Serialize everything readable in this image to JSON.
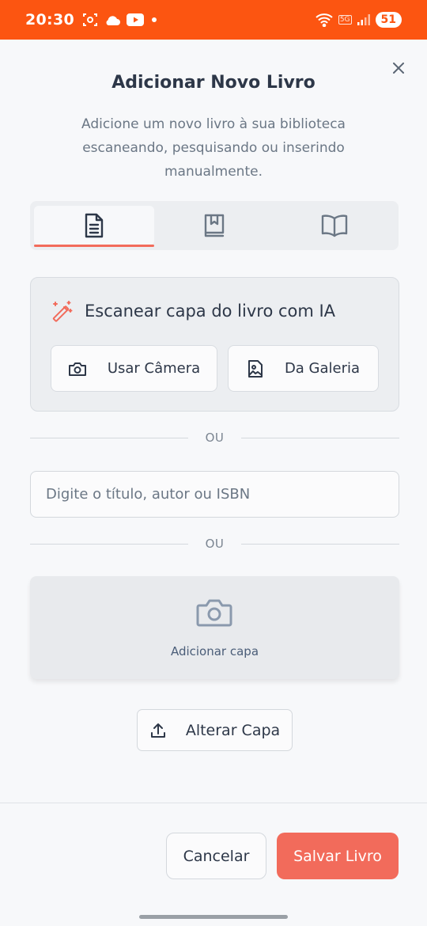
{
  "status_bar": {
    "time": "20:30",
    "battery": "51",
    "network_label": "5G"
  },
  "dialog": {
    "title": "Adicionar Novo Livro",
    "subtitle": "Adicione um novo livro à sua biblioteca escaneando, pesquisando ou inserindo manualmente.",
    "tabs": [
      {
        "icon": "document-icon",
        "active": true
      },
      {
        "icon": "book-bookmark-icon",
        "active": false
      },
      {
        "icon": "open-book-icon",
        "active": false
      }
    ],
    "scan": {
      "label": "Escanear capa do livro com IA",
      "camera_label": "Usar Câmera",
      "gallery_label": "Da Galeria"
    },
    "divider_text": "OU",
    "search": {
      "placeholder": "Digite o título, autor ou ISBN",
      "value": ""
    },
    "cover": {
      "label": "Adicionar capa",
      "change_label": "Alterar Capa"
    },
    "footer": {
      "cancel_label": "Cancelar",
      "save_label": "Salvar Livro"
    }
  },
  "colors": {
    "status_bar": "#fc5511",
    "accent": "#f26b5b",
    "cover_icon": "#8a99ad"
  }
}
